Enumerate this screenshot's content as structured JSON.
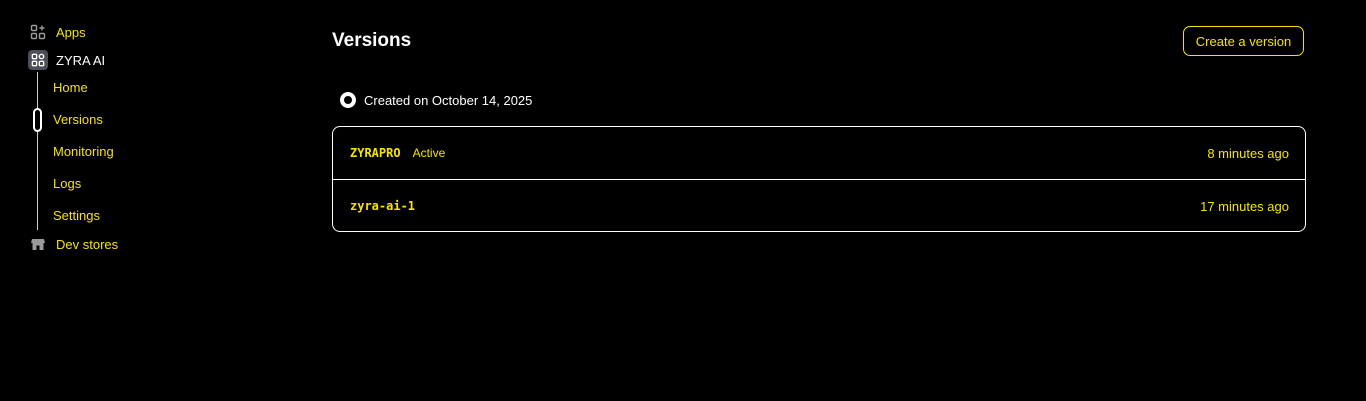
{
  "sidebar": {
    "apps_label": "Apps",
    "app_name": "ZYRA AI",
    "sub_items": [
      "Home",
      "Versions",
      "Monitoring",
      "Logs",
      "Settings"
    ],
    "active_item": "Versions",
    "dev_stores_label": "Dev stores",
    "icons": {
      "apps": "apps-grid-icon",
      "app": "app-icon",
      "dev_stores": "store-icon"
    }
  },
  "main": {
    "title": "Versions",
    "create_button_label": "Create a version",
    "created_label": "Created on October 14, 2025",
    "versions": [
      {
        "name": "ZYRAPRO",
        "status": "Active",
        "time": "8 minutes ago"
      },
      {
        "name": "zyra-ai-1",
        "status": "",
        "time": "17 minutes ago"
      }
    ]
  },
  "colors": {
    "background": "#000000",
    "accent": "#f5e400",
    "text": "#ffffff",
    "border": "#ffffff"
  }
}
